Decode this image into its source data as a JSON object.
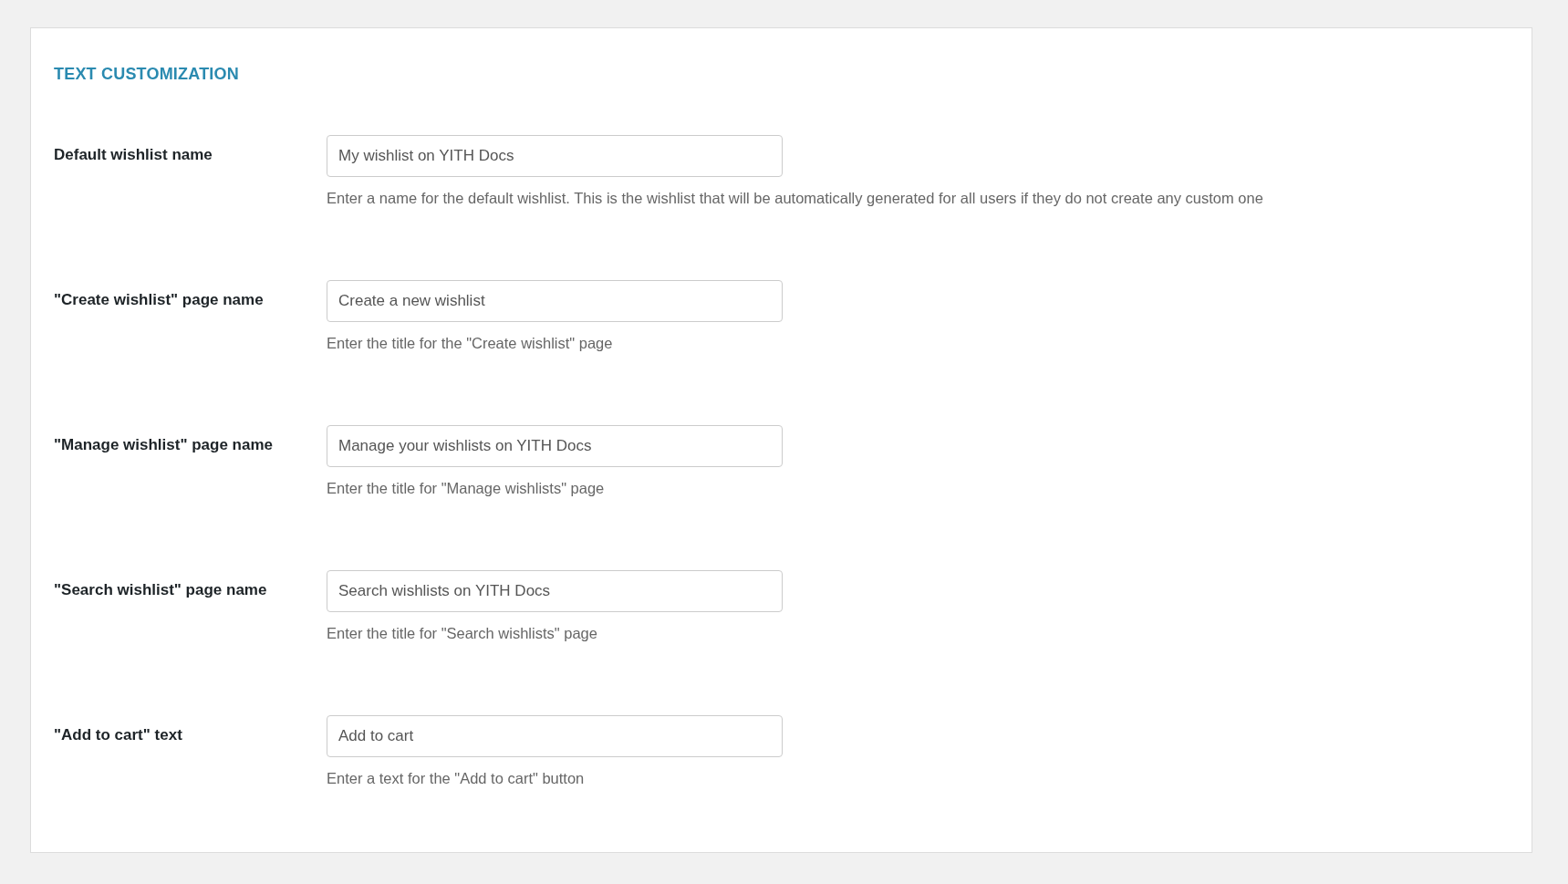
{
  "section": {
    "title": "TEXT CUSTOMIZATION"
  },
  "fields": [
    {
      "label": "Default wishlist name",
      "value": "My wishlist on YITH Docs",
      "description": "Enter a name for the default wishlist. This is the wishlist that will be automatically generated for all users if they do not create any custom one"
    },
    {
      "label": "\"Create wishlist\" page name",
      "value": "Create a new wishlist",
      "description": "Enter the title for the \"Create wishlist\" page"
    },
    {
      "label": "\"Manage wishlist\" page name",
      "value": "Manage your wishlists on YITH Docs",
      "description": "Enter the title for \"Manage wishlists\" page"
    },
    {
      "label": "\"Search wishlist\" page name",
      "value": "Search wishlists on YITH Docs",
      "description": "Enter the title for \"Search wishlists\" page"
    },
    {
      "label": "\"Add to cart\" text",
      "value": "Add to cart",
      "description": "Enter a text for the \"Add to cart\" button"
    }
  ]
}
